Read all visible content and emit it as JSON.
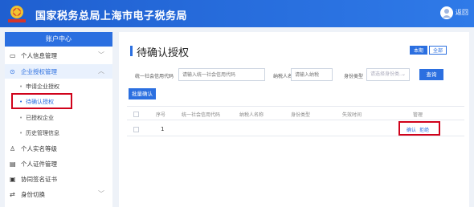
{
  "header": {
    "title": "国家税务总局上海市电子税务局",
    "emblem_icon": "tax-emblem-icon",
    "user_icon": "user-avatar-icon",
    "user_label": "返回"
  },
  "sidebar": {
    "title": "账户中心",
    "items": [
      {
        "label": "个人信息管理",
        "icon": "id-card-icon",
        "chevron": "﹀"
      },
      {
        "label": "企业授权管理",
        "icon": "check-circle-icon",
        "chevron": "︿"
      },
      {
        "label": "个人实名等级",
        "icon": "person-icon"
      },
      {
        "label": "个人证件管理",
        "icon": "certificate-icon"
      },
      {
        "label": "协同签名证书",
        "icon": "signature-icon"
      },
      {
        "label": "身份切换",
        "icon": "switch-icon",
        "chevron": "﹀"
      }
    ],
    "sub_items": [
      {
        "label": "申请企业授权"
      },
      {
        "label": "待确认授权"
      },
      {
        "label": "已授权企业"
      },
      {
        "label": "历史管理信息"
      }
    ]
  },
  "main": {
    "title": "待确认授权",
    "tabs": [
      {
        "label": "本期"
      },
      {
        "label": "全部"
      }
    ],
    "filters": {
      "credit_code_label": "统一社会信用代码",
      "credit_code_placeholder": "请输入统一社会信用代码",
      "taxpayer_name_label": "纳税人名称",
      "taxpayer_name_placeholder": "请输入纳税",
      "identity_type_label": "身份类型",
      "identity_type_value": "请选择身份类..."
    },
    "query_button": "查询",
    "batch_confirm_button": "批量确认",
    "table": {
      "headers": [
        "序号",
        "统一社会信用代码",
        "纳税人名称",
        "身份类型",
        "失效时间",
        "管理"
      ],
      "rows": [
        {
          "index": "1",
          "confirm": "确认",
          "reject": "拒绝"
        }
      ]
    }
  }
}
